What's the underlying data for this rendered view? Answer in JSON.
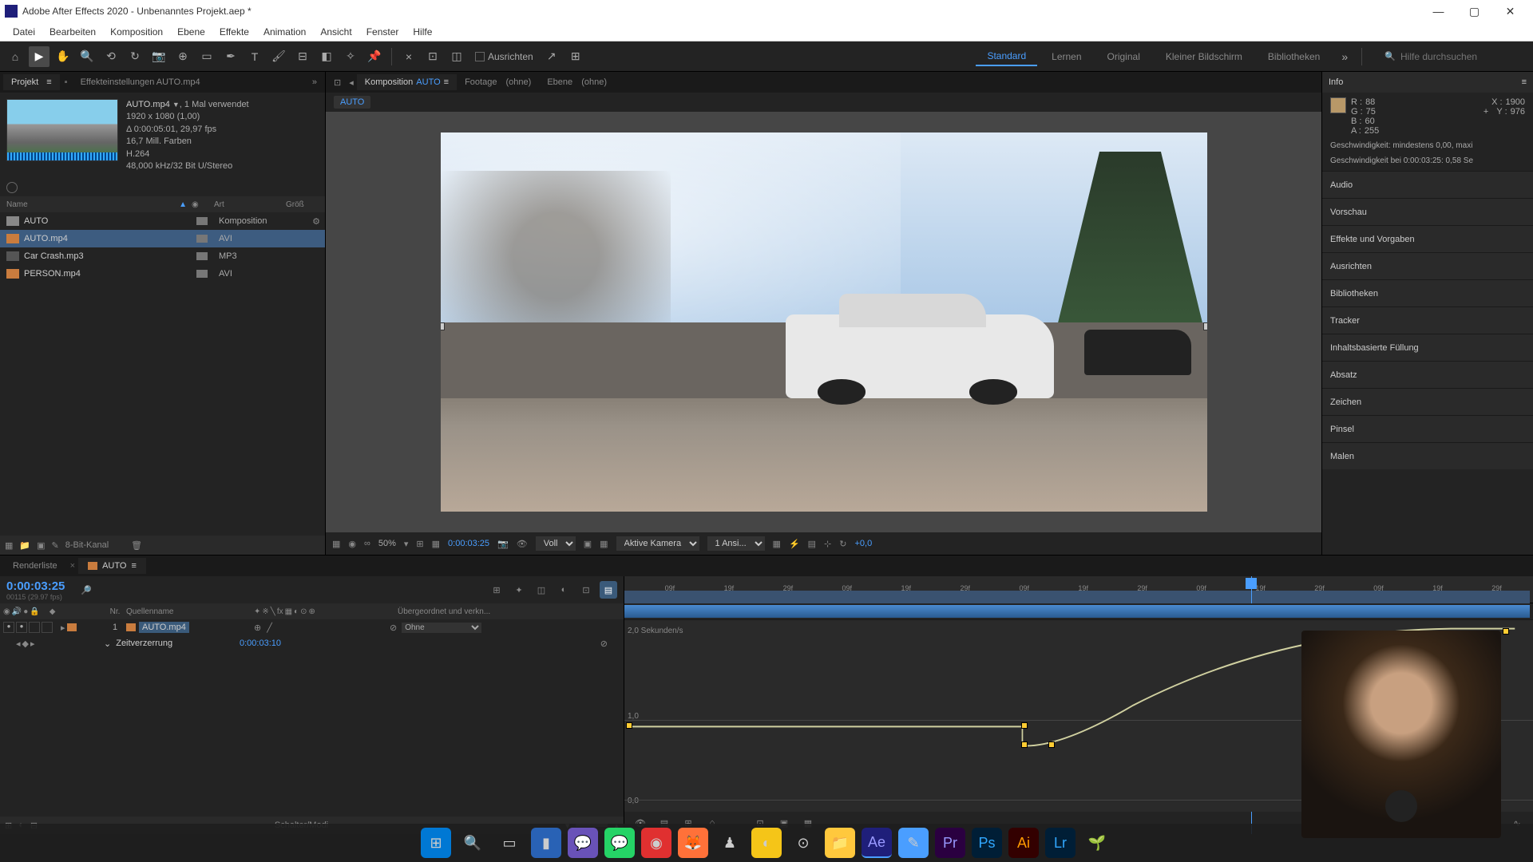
{
  "titlebar": {
    "title": "Adobe After Effects 2020 - Unbenanntes Projekt.aep *"
  },
  "menu": [
    "Datei",
    "Bearbeiten",
    "Komposition",
    "Ebene",
    "Effekte",
    "Animation",
    "Ansicht",
    "Fenster",
    "Hilfe"
  ],
  "toolbar": {
    "align": "Ausrichten",
    "workspaces": [
      "Standard",
      "Lernen",
      "Original",
      "Kleiner Bildschirm",
      "Bibliotheken"
    ],
    "search_ph": "Hilfe durchsuchen"
  },
  "project": {
    "tab_project": "Projekt",
    "tab_controls": "Effekteinstellungen  AUTO.mp4",
    "file": {
      "name": "AUTO.mp4",
      "usage": ", 1 Mal verwendet",
      "dim": "1920 x 1080 (1,00)",
      "dur": "Δ 0:00:05:01, 29,97 fps",
      "colors": "16,7 Mill. Farben",
      "codec": "H.264",
      "audio": "48,000 kHz/32 Bit U/Stereo"
    },
    "cols": {
      "name": "Name",
      "art": "Art",
      "size": "Größ"
    },
    "items": [
      {
        "name": "AUTO",
        "type": "Komposition"
      },
      {
        "name": "AUTO.mp4",
        "type": "AVI"
      },
      {
        "name": "Car Crash.mp3",
        "type": "MP3"
      },
      {
        "name": "PERSON.mp4",
        "type": "AVI"
      }
    ],
    "footer_depth": "8-Bit-Kanal"
  },
  "comp": {
    "tab_label": "Komposition",
    "tab_name": "AUTO",
    "tab_footage": "Footage",
    "tab_footage_v": "(ohne)",
    "tab_layer": "Ebene",
    "tab_layer_v": "(ohne)",
    "flow": "AUTO",
    "footer": {
      "zoom": "50%",
      "time": "0:00:03:25",
      "res": "Voll",
      "camera": "Aktive Kamera",
      "views": "1 Ansi...",
      "exp": "+0,0"
    }
  },
  "info": {
    "title": "Info",
    "r": "R :",
    "rv": "88",
    "g": "G :",
    "gv": "75",
    "b": "B :",
    "bv": "60",
    "a": "A :",
    "av": "255",
    "x": "X :",
    "xv": "1900",
    "y": "Y :",
    "yv": "976",
    "line1": "Geschwindigkeit: mindestens 0,00, maxi",
    "line2": "Geschwindigkeit bei 0:00:03:25: 0,58 Se"
  },
  "panels": [
    "Audio",
    "Vorschau",
    "Effekte und Vorgaben",
    "Ausrichten",
    "Bibliotheken",
    "Tracker",
    "Inhaltsbasierte Füllung",
    "Absatz",
    "Zeichen",
    "Pinsel",
    "Malen"
  ],
  "timeline": {
    "tab_render": "Renderliste",
    "tab_comp": "AUTO",
    "timecode": "0:00:03:25",
    "cols": {
      "nr": "Nr.",
      "src": "Quellenname",
      "parent": "Übergeordnet und verkn..."
    },
    "layer": {
      "nr": "1",
      "name": "AUTO.mp4",
      "parent": "Ohne"
    },
    "prop": {
      "name": "Zeitverzerrung",
      "value": "0:00:03:10"
    },
    "ruler_ticks": [
      "09f",
      "19f",
      "29f",
      "09f",
      "19f",
      "29f",
      "09f",
      "19f",
      "29f",
      "09f",
      "19f",
      "29f",
      "09f",
      "19f",
      "29f"
    ],
    "graph": {
      "ytop": "2,0 Sekunden/s",
      "ymid": "1,0",
      "ybot": "0,0"
    },
    "footer": "Schalter/Modi"
  }
}
